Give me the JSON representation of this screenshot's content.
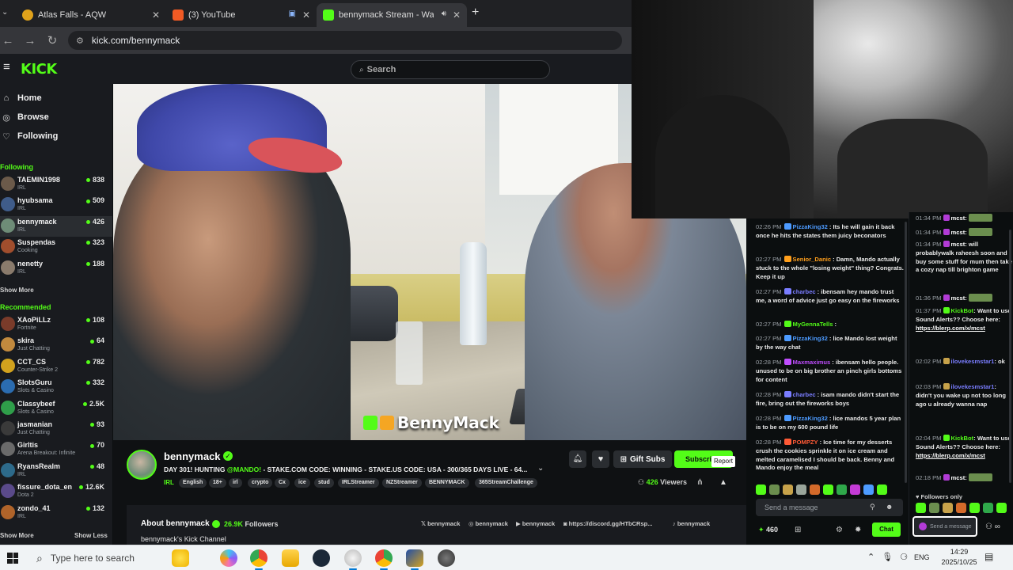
{
  "tabs": [
    {
      "title": "Atlas Falls - AQW",
      "favicon_color": "#e0a21b"
    },
    {
      "title": "(3) YouTube",
      "favicon_color": "#f15a24"
    },
    {
      "title": "bennymack Stream - Watch",
      "favicon_color": "#53fc18"
    }
  ],
  "address": {
    "url": "kick.com/bennymack"
  },
  "header": {
    "logo": "KICK",
    "search_placeholder": "Search"
  },
  "nav": [
    {
      "label": "Home",
      "icon": "home-icon"
    },
    {
      "label": "Browse",
      "icon": "compass-icon"
    },
    {
      "label": "Following",
      "icon": "heart-icon"
    }
  ],
  "following": {
    "title": "Following",
    "channels": [
      {
        "name": "TAEMIN1998",
        "category": "IRL",
        "viewers": "838",
        "color": "#6b5a4a"
      },
      {
        "name": "hyubsama",
        "category": "IRL",
        "viewers": "509",
        "color": "#3f5c8a"
      },
      {
        "name": "bennymack",
        "category": "IRL",
        "viewers": "426",
        "color": "#6e8c77"
      },
      {
        "name": "Suspendas",
        "category": "Cooking",
        "viewers": "323",
        "color": "#a14e2d"
      },
      {
        "name": "nenetty",
        "category": "IRL",
        "viewers": "188",
        "color": "#8a7b6c"
      }
    ],
    "show_more": "Show More"
  },
  "recommended": {
    "title": "Recommended",
    "channels": [
      {
        "name": "XAoPiLLz",
        "category": "Fortnite",
        "viewers": "108",
        "color": "#7a3b2a"
      },
      {
        "name": "skira",
        "category": "Just Chatting",
        "viewers": "64",
        "color": "#c28a3e"
      },
      {
        "name": "CCT_CS",
        "category": "Counter-Strike 2",
        "viewers": "782",
        "color": "#d1a21e"
      },
      {
        "name": "SlotsGuru",
        "category": "Slots & Casino",
        "viewers": "332",
        "color": "#2b6cb0"
      },
      {
        "name": "Classybeef",
        "category": "Slots & Casino",
        "viewers": "2.5K",
        "color": "#2f9e4a"
      },
      {
        "name": "jasmanian",
        "category": "Just Chatting",
        "viewers": "93",
        "color": "#3a3a3a"
      },
      {
        "name": "Girltis",
        "category": "Arena Breakout: Infinite",
        "viewers": "70",
        "color": "#6a6a6a"
      },
      {
        "name": "RyansRealm",
        "category": "IRL",
        "viewers": "48",
        "color": "#2d6a8a"
      },
      {
        "name": "fissure_dota_en",
        "category": "Dota 2",
        "viewers": "12.6K",
        "color": "#5a4a8a"
      },
      {
        "name": "zondo_41",
        "category": "IRL",
        "viewers": "132",
        "color": "#b0642a"
      }
    ],
    "show_more": "Show More",
    "show_less": "Show Less"
  },
  "video": {
    "watermark": "BennyMack"
  },
  "stream": {
    "name": "bennymack",
    "title_prefix": "DAY 301! HUNTING ",
    "title_mention": "@MANDO!",
    "title_rest": " - STAKE.COM CODE: WINNING - STAKE.US CODE: USA - 300/365 DAYS LIVE - 64...",
    "category": "IRL",
    "tags": [
      "English",
      "18+",
      "irl",
      "crypto",
      "Cx",
      "ice",
      "stud",
      "IRLStreamer",
      "NZStreamer",
      "BENNYMACK",
      "365StreamChallenge"
    ],
    "viewers": "426",
    "viewers_label": "Viewers",
    "gift_label": "Gift Subs",
    "subscribe_label": "Subscribe",
    "report_tooltip": "Report"
  },
  "about": {
    "title": "About bennymack",
    "followers_count": "26.9K",
    "followers_label": "Followers",
    "description": "bennymack's Kick Channel",
    "socials": [
      "bennymack",
      "bennymack",
      "bennymack",
      "https://discord.gg/HTbCRsp...",
      "bennymack"
    ]
  },
  "chat1": {
    "messages": [
      {
        "time": "02:26 PM",
        "user": "PizzaKing32",
        "user_color": "#4d9bff",
        "text": "Its he will gain it back once he hits the states them juicy beconators"
      },
      {
        "time": "02:27 PM",
        "user": "Senior_Danic",
        "user_color": "#ff9f1c",
        "text": "Damn, Mando actually stuck to the whole \"losing weight\" thing? Congrats. Keep it up"
      },
      {
        "time": "02:27 PM",
        "user": "charbec",
        "user_color": "#7a7dff",
        "text": "ibensam hey mando trust me, a word of advice just go easy on the fireworks"
      },
      {
        "time": "02:27 PM",
        "user": "MyGennaTells",
        "user_color": "#53fc18",
        "text": ""
      },
      {
        "time": "02:27 PM",
        "user": "PizzaKing32",
        "user_color": "#4d9bff",
        "text": "lice Mando lost weight by the way chat"
      },
      {
        "time": "02:28 PM",
        "user": "Maxmaximus",
        "user_color": "#c04dff",
        "text": "ibensam hello people. unused to be on big brother an pinch girls bottoms for content"
      },
      {
        "time": "02:28 PM",
        "user": "charbec",
        "user_color": "#7a7dff",
        "text": "isam mando didn't start the fire, bring out the fireworks boys"
      },
      {
        "time": "02:28 PM",
        "user": "PizzaKing32",
        "user_color": "#4d9bff",
        "text": "lice mandos 5 year plan is to be on my 600 pound life"
      },
      {
        "time": "02:28 PM",
        "user": "POMPZY",
        "user_color": "#ff5a36",
        "text": "Ice time for my desserts crush the cookies sprinkle it on ice cream and melted caramelised I should be back. Benny and Mando enjoy the meal"
      }
    ],
    "input_placeholder": "Send a message",
    "points": "460",
    "send_label": "Chat"
  },
  "chat2": {
    "messages": [
      {
        "time": "01:34 PM",
        "user": "mcst",
        "text": ""
      },
      {
        "time": "01:34 PM",
        "user": "mcst",
        "text": ""
      },
      {
        "time": "01:34 PM",
        "user": "mcst",
        "text": "will probablywalk raheesh soon and buy some stuff for mum then take a cozy nap till brighton game"
      },
      {
        "time": "01:36 PM",
        "user": "mcst",
        "text": ""
      },
      {
        "time": "01:37 PM",
        "user": "KickBot",
        "text": "Want to use Sound Alerts?? Choose here:",
        "link": "https://blerp.com/x/mcst"
      },
      {
        "time": "02:02 PM",
        "user": "ilovekesmstar1",
        "text": "ok"
      },
      {
        "time": "02:03 PM",
        "user": "ilovekesmstar1",
        "text": "didn't you wake up not too long ago u already wanna nap"
      },
      {
        "time": "02:04 PM",
        "user": "KickBot",
        "text": "Want to use Sound Alerts?? Choose here:",
        "link": "https://blerp.com/x/mcst"
      },
      {
        "time": "02:18 PM",
        "user": "mcst",
        "text": ""
      }
    ],
    "followers_only": "Followers only",
    "input_placeholder": "Send a message"
  },
  "taskbar": {
    "search_placeholder": "Type here to search",
    "language": "ENG",
    "time": "14:29",
    "date": "2025/10/25"
  }
}
